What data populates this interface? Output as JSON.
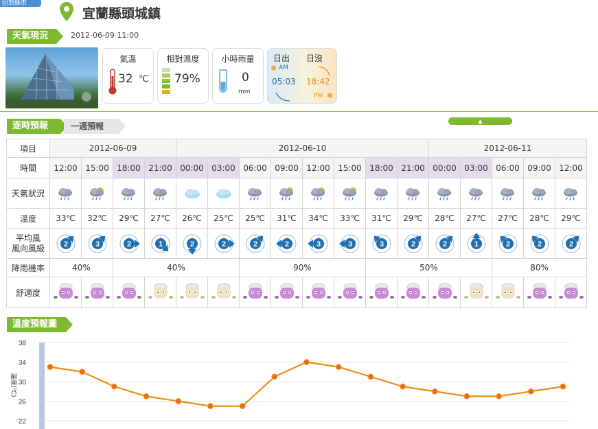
{
  "header": {
    "back_label": "回到縣市",
    "city": "宜蘭縣頭城鎮"
  },
  "current": {
    "section_label": "天氣現況",
    "time": "2012-06-09 11:00",
    "temp_title": "氣溫",
    "temp_value": "32",
    "temp_unit": "℃",
    "hum_title": "相對濕度",
    "hum_value": "79%",
    "rain_title": "小時雨量",
    "rain_value": "0",
    "rain_unit": "mm",
    "sunrise_title": "日出",
    "sunset_title": "日沒",
    "am_label": "AM",
    "pm_label": "PM",
    "sunrise": "05:03",
    "sunset": "18:42"
  },
  "tabs": {
    "hourly": "逐時預報",
    "weekly": "一週預報"
  },
  "forecast": {
    "row_labels": {
      "item": "項目",
      "time": "時間",
      "weather": "天氣狀況",
      "temp": "溫度",
      "wind1": "平均風",
      "wind2": "風向風級",
      "pop": "降雨機率",
      "comfort": "舒適度"
    },
    "dates": [
      {
        "label": "2012-06-09",
        "span": 4
      },
      {
        "label": "2012-06-10",
        "span": 8
      },
      {
        "label": "2012-06-11",
        "span": 5
      }
    ],
    "times": [
      "12:00",
      "15:00",
      "18:00",
      "21:00",
      "00:00",
      "03:00",
      "06:00",
      "09:00",
      "12:00",
      "15:00",
      "18:00",
      "21:00",
      "00:00",
      "03:00",
      "06:00",
      "09:00",
      "12:00"
    ],
    "night": [
      false,
      false,
      true,
      true,
      true,
      true,
      false,
      false,
      false,
      false,
      true,
      true,
      true,
      true,
      false,
      false,
      false
    ],
    "weather_icons": [
      "cloud-rain-icon",
      "sun-cloud-rain-icon",
      "cloud-rain-icon",
      "cloud-rain-icon",
      "cloud-icon",
      "cloud-icon",
      "cloud-rain-icon",
      "sun-cloud-rain-icon",
      "sun-cloud-rain-icon",
      "sun-cloud-rain-icon",
      "cloud-rain-icon",
      "cloud-rain-icon",
      "cloud-rain-icon",
      "cloud-rain-icon",
      "cloud-rain-icon",
      "cloud-rain-icon",
      "cloud-rain-icon"
    ],
    "temps": [
      "33℃",
      "32℃",
      "29℃",
      "27℃",
      "26℃",
      "25℃",
      "25℃",
      "31℃",
      "34℃",
      "33℃",
      "31℃",
      "29℃",
      "28℃",
      "27℃",
      "27℃",
      "28℃",
      "29℃"
    ],
    "wind_levels": [
      "2",
      "3",
      "2",
      "1",
      "2",
      "2",
      "2",
      "2",
      "3",
      "3",
      "3",
      "2",
      "2",
      "1",
      "2",
      "2",
      "2"
    ],
    "wind_dirs": [
      "ne",
      "ne",
      "e",
      "se",
      "s",
      "e",
      "ne",
      "w",
      "w",
      "w",
      "nw",
      "ne",
      "ne",
      "n",
      "nw",
      "nw",
      "ne"
    ],
    "pop": [
      {
        "value": "40%",
        "span": 2
      },
      {
        "value": "40%",
        "span": 4
      },
      {
        "value": "90%",
        "span": 4
      },
      {
        "value": "50%",
        "span": 4
      },
      {
        "value": "80%",
        "span": 3
      }
    ],
    "comfort": [
      "pink",
      "pink",
      "pink",
      "beige",
      "beige",
      "beige",
      "pink",
      "pink",
      "pink",
      "pink",
      "pink",
      "pink",
      "pink",
      "beige",
      "beige",
      "pink",
      "pink"
    ]
  },
  "chart_section_label": "溫度預報圖",
  "colors": {
    "green": "#7dba2f",
    "orange": "#e8900c",
    "arrow_blue": "#1f6fb2"
  },
  "chart_data": {
    "type": "line",
    "title": "",
    "ylabel": "溫度(℃)",
    "xlabel": "",
    "ylim": [
      22,
      38
    ],
    "yticks": [
      22,
      26,
      30,
      34,
      38
    ],
    "series": [
      {
        "values": [
          33,
          32,
          29,
          27,
          26,
          25,
          25,
          31,
          34,
          33,
          31,
          29,
          28,
          27,
          27,
          28,
          29
        ]
      }
    ]
  }
}
